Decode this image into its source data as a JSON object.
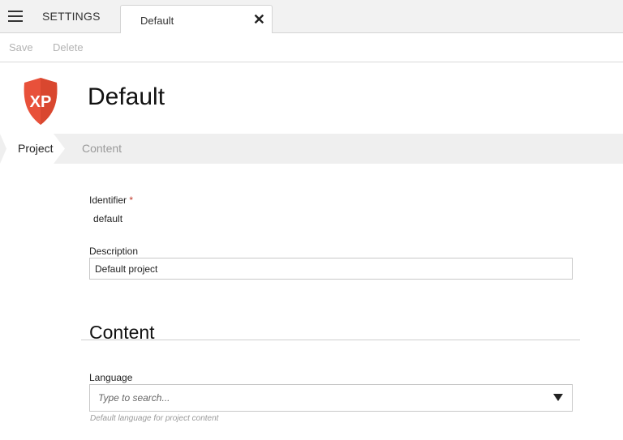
{
  "app": {
    "title": "SETTINGS"
  },
  "tab": {
    "label": "Default",
    "close_glyph": "✕"
  },
  "toolbar": {
    "save_label": "Save",
    "delete_label": "Delete"
  },
  "header": {
    "logo_text": "XP",
    "title": "Default"
  },
  "steps": [
    {
      "label": "Project",
      "active": true
    },
    {
      "label": "Content",
      "active": false
    }
  ],
  "project": {
    "identifier_label": "Identifier",
    "required_mark": "*",
    "identifier_value": "default",
    "description_label": "Description",
    "description_value": "Default project"
  },
  "content": {
    "section_title": "Content",
    "language_label": "Language",
    "language_placeholder": "Type to search...",
    "language_help": "Default language for project content"
  },
  "colors": {
    "logo_red": "#e8513a",
    "logo_red_dark": "#c9402c",
    "required": "#c0392b",
    "muted": "#9a9a9a"
  },
  "icons": [
    "hamburger-menu-icon",
    "close-icon",
    "xp-logo-icon",
    "dropdown-arrow-icon"
  ]
}
